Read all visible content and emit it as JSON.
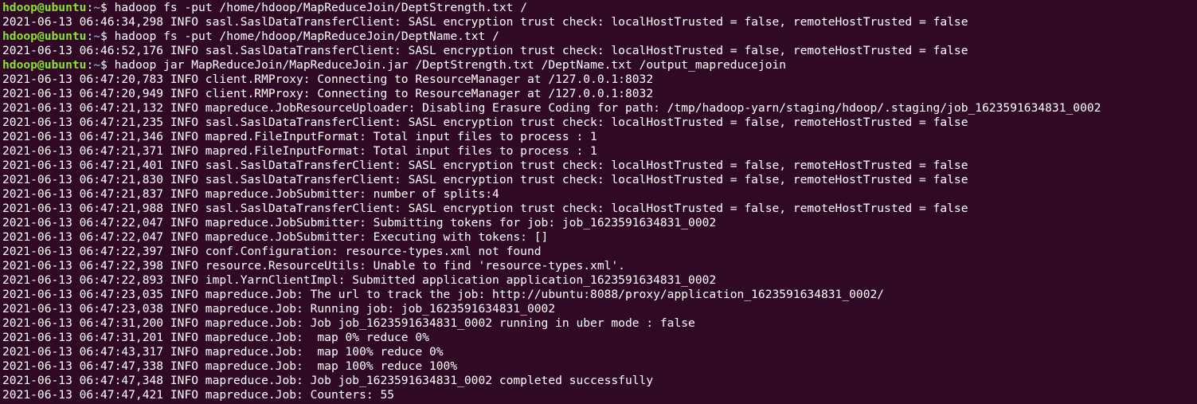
{
  "prompt": {
    "user_host": "hdoop@ubuntu",
    "colon": ":",
    "path": "~",
    "symbol": "$ "
  },
  "lines": [
    {
      "type": "cmd",
      "text": "hadoop fs -put /home/hdoop/MapReduceJoin/DeptStrength.txt /"
    },
    {
      "type": "out",
      "text": "2021-06-13 06:46:34,298 INFO sasl.SaslDataTransferClient: SASL encryption trust check: localHostTrusted = false, remoteHostTrusted = false"
    },
    {
      "type": "cmd",
      "text": "hadoop fs -put /home/hdoop/MapReduceJoin/DeptName.txt /"
    },
    {
      "type": "out",
      "text": "2021-06-13 06:46:52,176 INFO sasl.SaslDataTransferClient: SASL encryption trust check: localHostTrusted = false, remoteHostTrusted = false"
    },
    {
      "type": "cmd",
      "text": "hadoop jar MapReduceJoin/MapReduceJoin.jar /DeptStrength.txt /DeptName.txt /output_mapreducejoin"
    },
    {
      "type": "out",
      "text": "2021-06-13 06:47:20,783 INFO client.RMProxy: Connecting to ResourceManager at /127.0.0.1:8032"
    },
    {
      "type": "out",
      "text": "2021-06-13 06:47:20,949 INFO client.RMProxy: Connecting to ResourceManager at /127.0.0.1:8032"
    },
    {
      "type": "out",
      "text": "2021-06-13 06:47:21,132 INFO mapreduce.JobResourceUploader: Disabling Erasure Coding for path: /tmp/hadoop-yarn/staging/hdoop/.staging/job_1623591634831_0002"
    },
    {
      "type": "out",
      "text": "2021-06-13 06:47:21,235 INFO sasl.SaslDataTransferClient: SASL encryption trust check: localHostTrusted = false, remoteHostTrusted = false"
    },
    {
      "type": "out",
      "text": "2021-06-13 06:47:21,346 INFO mapred.FileInputFormat: Total input files to process : 1"
    },
    {
      "type": "out",
      "text": "2021-06-13 06:47:21,371 INFO mapred.FileInputFormat: Total input files to process : 1"
    },
    {
      "type": "out",
      "text": "2021-06-13 06:47:21,401 INFO sasl.SaslDataTransferClient: SASL encryption trust check: localHostTrusted = false, remoteHostTrusted = false"
    },
    {
      "type": "out",
      "text": "2021-06-13 06:47:21,830 INFO sasl.SaslDataTransferClient: SASL encryption trust check: localHostTrusted = false, remoteHostTrusted = false"
    },
    {
      "type": "out",
      "text": "2021-06-13 06:47:21,837 INFO mapreduce.JobSubmitter: number of splits:4"
    },
    {
      "type": "out",
      "text": "2021-06-13 06:47:21,988 INFO sasl.SaslDataTransferClient: SASL encryption trust check: localHostTrusted = false, remoteHostTrusted = false"
    },
    {
      "type": "out",
      "text": "2021-06-13 06:47:22,047 INFO mapreduce.JobSubmitter: Submitting tokens for job: job_1623591634831_0002"
    },
    {
      "type": "out",
      "text": "2021-06-13 06:47:22,047 INFO mapreduce.JobSubmitter: Executing with tokens: []"
    },
    {
      "type": "out",
      "text": "2021-06-13 06:47:22,397 INFO conf.Configuration: resource-types.xml not found"
    },
    {
      "type": "out",
      "text": "2021-06-13 06:47:22,398 INFO resource.ResourceUtils: Unable to find 'resource-types.xml'."
    },
    {
      "type": "out",
      "text": "2021-06-13 06:47:22,893 INFO impl.YarnClientImpl: Submitted application application_1623591634831_0002"
    },
    {
      "type": "out",
      "text": "2021-06-13 06:47:23,035 INFO mapreduce.Job: The url to track the job: http://ubuntu:8088/proxy/application_1623591634831_0002/"
    },
    {
      "type": "out",
      "text": "2021-06-13 06:47:23,038 INFO mapreduce.Job: Running job: job_1623591634831_0002"
    },
    {
      "type": "out",
      "text": "2021-06-13 06:47:31,200 INFO mapreduce.Job: Job job_1623591634831_0002 running in uber mode : false"
    },
    {
      "type": "out",
      "text": "2021-06-13 06:47:31,201 INFO mapreduce.Job:  map 0% reduce 0%"
    },
    {
      "type": "out",
      "text": "2021-06-13 06:47:43,317 INFO mapreduce.Job:  map 100% reduce 0%"
    },
    {
      "type": "out",
      "text": "2021-06-13 06:47:47,338 INFO mapreduce.Job:  map 100% reduce 100%"
    },
    {
      "type": "out",
      "text": "2021-06-13 06:47:47,348 INFO mapreduce.Job: Job job_1623591634831_0002 completed successfully"
    },
    {
      "type": "out",
      "text": "2021-06-13 06:47:47,421 INFO mapreduce.Job: Counters: 55"
    }
  ],
  "colors": {
    "background": "#300a24",
    "foreground": "#ffffff",
    "prompt_user": "#8ae234",
    "prompt_path": "#729fcf"
  }
}
